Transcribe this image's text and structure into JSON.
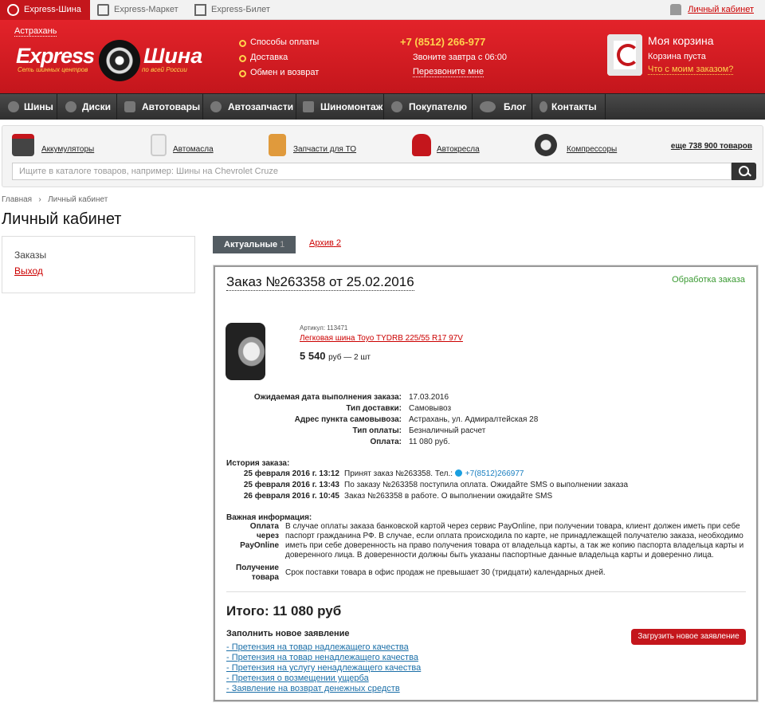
{
  "top": {
    "tabs": [
      "Express-Шина",
      "Express-Маркет",
      "Express-Билет"
    ],
    "account": "Личный кабинет"
  },
  "header": {
    "city": "Астрахань",
    "logo_left": "Express",
    "logo_right": "Шина",
    "tag_left": "Сеть шинных центров",
    "tag_right": "по всей России",
    "links": [
      "Способы оплаты",
      "Доставка",
      "Обмен и возврат"
    ],
    "phone": "+7 (8512) 266-977",
    "call_text": "Звоните завтра с 06:00",
    "callback": "Перезвоните мне",
    "cart_title": "Моя корзина",
    "cart_status": "Корзина пуста",
    "cart_link": "Что с моим заказом?"
  },
  "nav": [
    "Шины",
    "Диски",
    "Автотовары",
    "Автозапчасти",
    "Шиномонтаж",
    "Покупателю",
    "Блог",
    "Контакты"
  ],
  "categories": [
    "Аккумуляторы",
    "Автомасла",
    "Запчасти для ТО",
    "Автокресла",
    "Компрессоры"
  ],
  "more_products": "еще 738 900 товаров",
  "search": {
    "placeholder": "Ищите в каталоге товаров, например: Шины на Chevrolet Cruze"
  },
  "breadcrumb": [
    "Главная",
    "Личный кабинет"
  ],
  "page_title": "Личный кабинет",
  "sidebar": {
    "orders": "Заказы",
    "logout": "Выход"
  },
  "tabs": {
    "current": "Актуальные",
    "current_count": "1",
    "archive": "Архив",
    "archive_count": "2"
  },
  "order": {
    "title": "Заказ №263358 от 25.02.2016",
    "status": "Обработка заказа",
    "article": "Артикул: 113471",
    "product": "Легковая шина Toyo TYDRB 225/55 R17 97V",
    "price": "5 540",
    "price_unit": "руб — 2 шт",
    "details": [
      {
        "k": "Ожидаемая дата выполнения заказа:",
        "v": "17.03.2016"
      },
      {
        "k": "Тип доставки:",
        "v": "Самовывоз"
      },
      {
        "k": "Адрес пункта самовывоза:",
        "v": "Астрахань, ул. Адмиралтейская 28"
      },
      {
        "k": "Тип оплаты:",
        "v": "Безналичный расчет"
      },
      {
        "k": "Оплата:",
        "v": "11 080 руб."
      }
    ],
    "history_title": "История заказа:",
    "history": [
      {
        "d": "25 февраля 2016 г. 13:12",
        "t": "Принят заказ №263358. Тел.:",
        "phone": "+7(8512)266977"
      },
      {
        "d": "25 февраля 2016 г. 13:43",
        "t": "По заказу №263358 поступила оплата. Ожидайте SMS о выполнении заказа"
      },
      {
        "d": "26 февраля 2016 г. 10:45",
        "t": "Заказ №263358 в работе. О выполнении ожидайте SMS"
      }
    ],
    "info_title": "Важная информация:",
    "info": [
      {
        "k": "Оплата через PayOnline",
        "v": "В случае оплаты заказа банковской картой через сервис PayOnline, при получении товара, клиент должен иметь при себе паспорт гражданина РФ. В случае, если оплата происходила по карте, не принадлежащей получателю заказа, необходимо иметь при себе доверенность на право получения товара от владельца карты, а так же копию паспорта владельца карты и доверенного лица. В доверенности должны быть указаны паспортные данные владельца карты и доверенно лица."
      },
      {
        "k": "Получение товара",
        "v": "Срок поставки товара в офис продаж не превышает 30 (тридцати) календарных дней."
      }
    ],
    "total": "Итого: 11 080 руб",
    "claims_title": "Заполнить новое заявление",
    "claims": [
      "- Претензия на товар надлежащего качества",
      "- Претензия на товар ненадлежащего качества",
      "- Претензия на услугу ненадлежащего качества",
      "- Претензия о возмещении ущерба",
      "- Заявление на возврат денежных средств"
    ],
    "upload": "Загрузить новое заявление"
  }
}
